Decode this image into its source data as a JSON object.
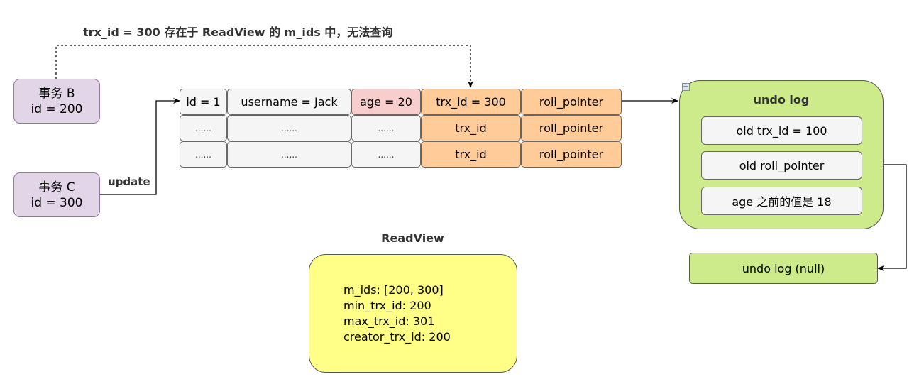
{
  "annotation": {
    "text": "trx_id = 300 存在于 ReadView 的 m_ids 中，无法查询"
  },
  "transactions": [
    {
      "label": "事务 B",
      "id_text": "id = 200"
    },
    {
      "label": "事务 C",
      "id_text": "id = 300"
    }
  ],
  "edge_labels": {
    "update": "update"
  },
  "record_table": {
    "rows": [
      [
        "id = 1",
        "username = Jack",
        "age = 20",
        "trx_id = 300",
        "roll_pointer"
      ],
      [
        "......",
        "......",
        "......",
        "trx_id",
        "roll_pointer"
      ],
      [
        "......",
        "......",
        "......",
        "trx_id",
        "roll_pointer"
      ]
    ]
  },
  "undo_log": {
    "title": "undo log",
    "items": [
      "old trx_id = 100",
      "old roll_pointer",
      "age 之前的值是 18"
    ],
    "collapse_symbol": "−",
    "next": "undo log (null)"
  },
  "readview": {
    "title": "ReadView",
    "lines": [
      "m_ids: [200, 300]",
      "min_trx_id: 200",
      "max_trx_id: 301",
      "creator_trx_id: 200"
    ]
  },
  "colors": {
    "transaction_fill": "#e1d5e7",
    "transaction_border": "#9673a6",
    "cell_gray": "#f5f5f5",
    "cell_pink": "#f8cecc",
    "cell_orange": "#ffcc99",
    "undo_green": "#cdeb8b",
    "readview_yellow": "#ffff88"
  }
}
